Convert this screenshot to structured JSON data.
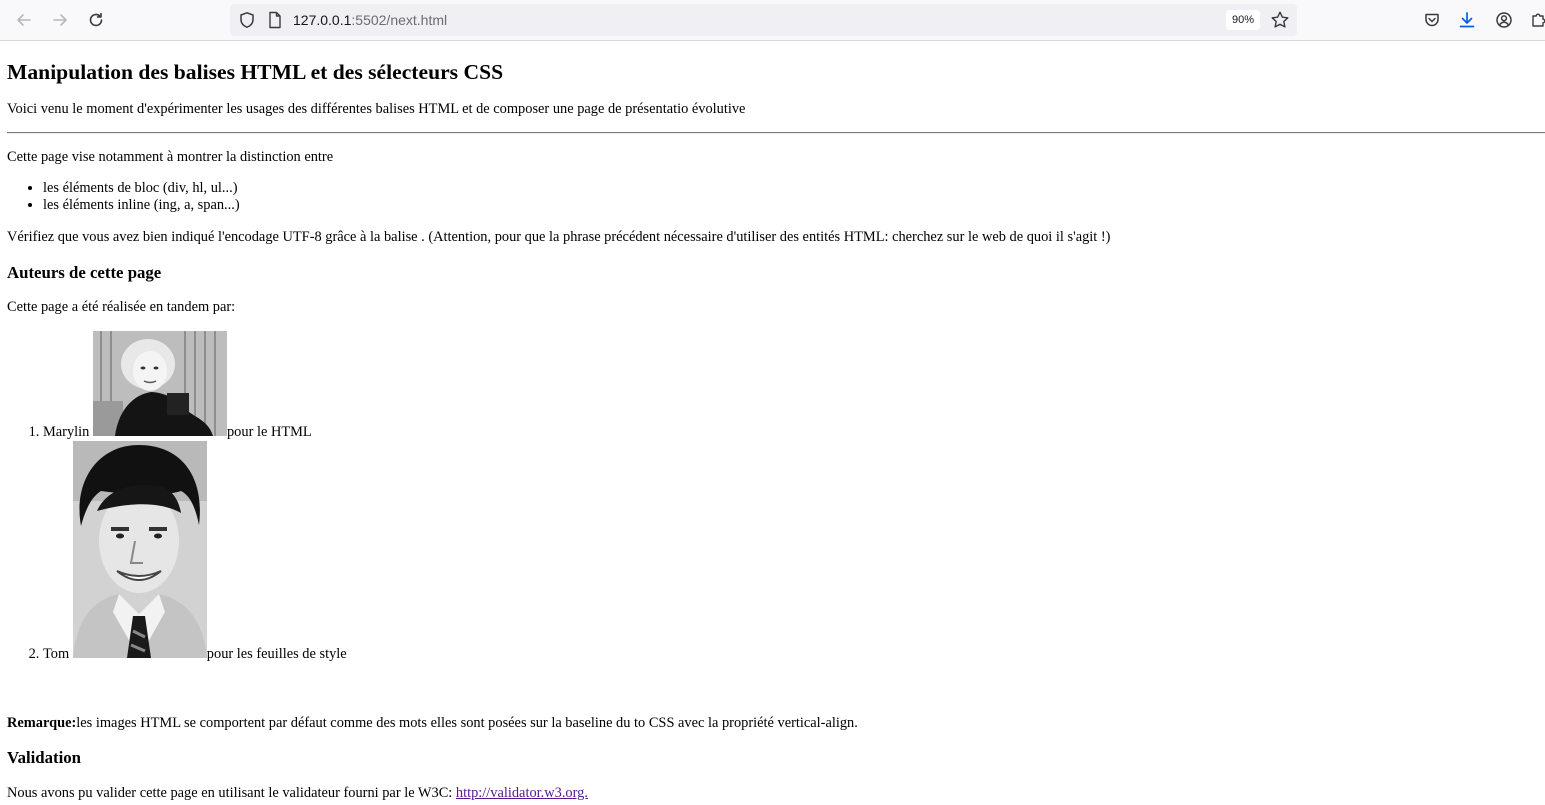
{
  "browser": {
    "url_host": "127.0.0.1",
    "url_rest": ":5502/next.html",
    "zoom": "90%"
  },
  "page": {
    "title": "Manipulation des balises HTML et des sélecteurs CSS",
    "intro": "Voici venu le moment d'expérimenter les usages des différentes balises HTML et de composer une page de présentatio évolutive",
    "aim": "Cette page vise notamment à montrer la distinction entre",
    "kinds": [
      "les éléments de bloc (div, hl, ul...)",
      "les éléments inline (ing, a, span...)"
    ],
    "verify": "Vérifiez que vous avez bien indiqué l'encodage UTF-8 grâce à la balise . (Attention, pour que la phrase précédent nécessaire d'utiliser des entités HTML: cherchez sur le web de quoi il s'agit !)",
    "authors_heading": "Auteurs de cette page",
    "made_by": "Cette page a été réalisée en tandem par:",
    "authors": [
      {
        "name": "Marylin",
        "role": "pour le HTML"
      },
      {
        "name": "Tom",
        "role": "pour les feuilles de style"
      }
    ],
    "remark_label": "Remarque:",
    "remark_text": "les images HTML se comportent par défaut comme des mots elles sont posées sur la baseline du to CSS avec la propriété vertical-align.",
    "validation_heading": "Validation",
    "validation_text": "Nous avons pu valider cette page en utilisant le validateur fourni par le W3C: ",
    "validation_link": "http://validator.w3.org."
  }
}
